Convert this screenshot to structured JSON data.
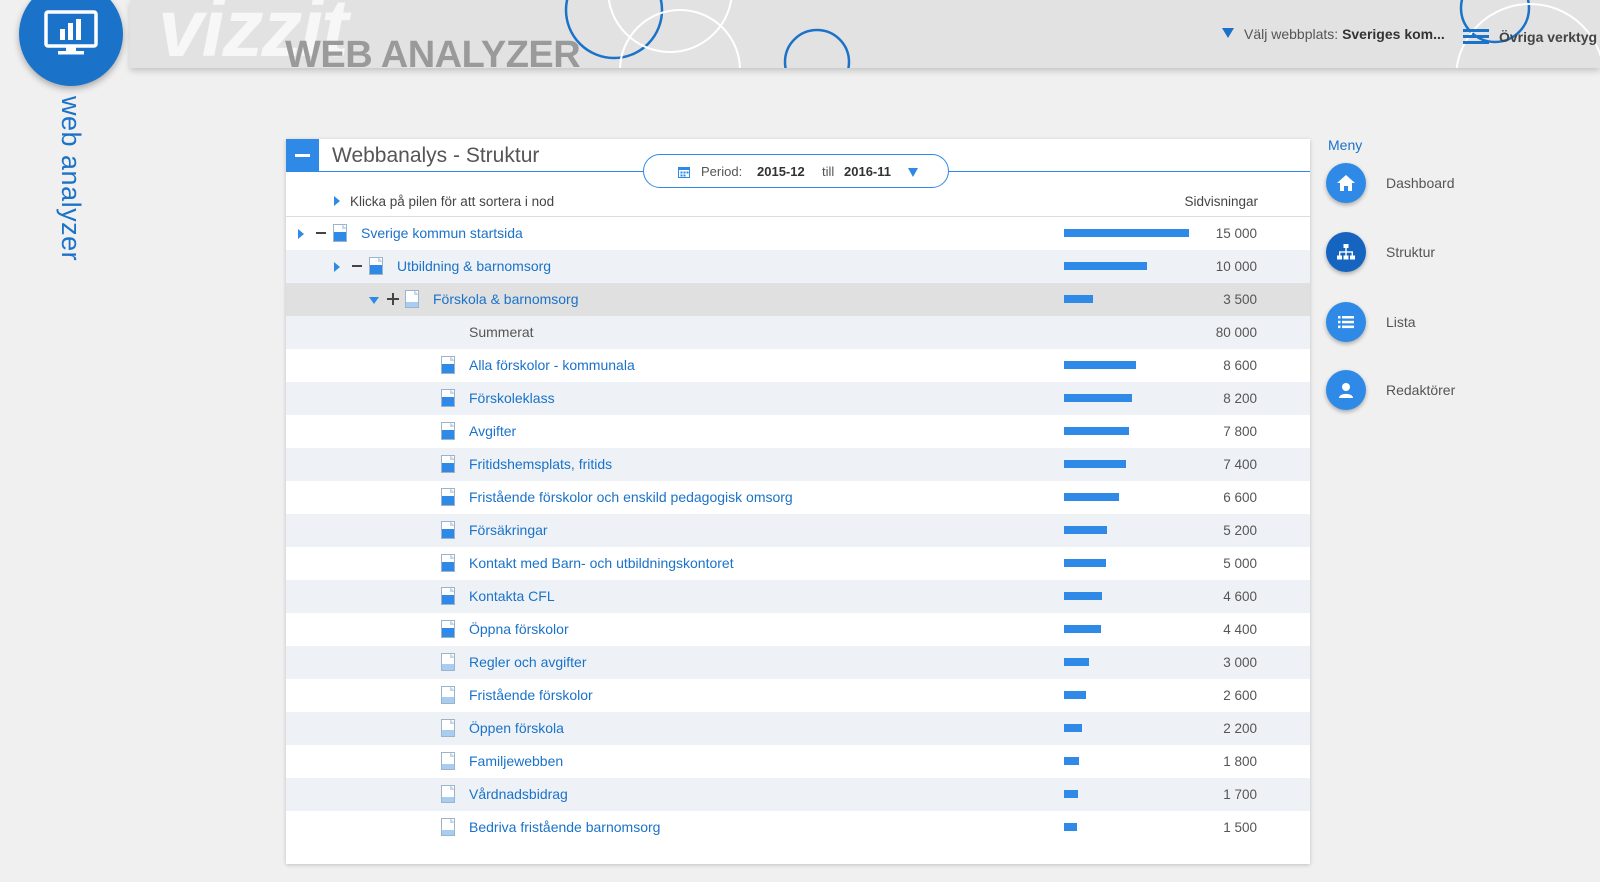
{
  "header": {
    "brand_bg": "vizzit",
    "brand_fg": "WEB ANALYZER",
    "site_select_prefix": "Välj webbplats:",
    "site_select_value": "Sveriges kom...",
    "tools_label": "Övriga verktyg"
  },
  "app": {
    "vertical_title": "web analyzer"
  },
  "panel": {
    "title": "Webbanalys - Struktur",
    "period_label": "Period:",
    "period_from": "2015-12",
    "period_till": "till",
    "period_to": "2016-11",
    "hint": "Klicka på pilen för att sortera i nod",
    "column_header": "Sidvisningar",
    "bar_max": 15000,
    "rows": [
      {
        "label": "Sverige kommun startsida",
        "value": "15 000",
        "num": 15000,
        "level": 0,
        "controls": "arrow-minus",
        "doc": 0.55
      },
      {
        "label": "Utbildning & barnomsorg",
        "value": "10 000",
        "num": 10000,
        "level": 1,
        "controls": "arrow-minus",
        "doc": 0.55
      },
      {
        "label": "Förskola & barnomsorg",
        "value": "3 500",
        "num": 3500,
        "level": 2,
        "controls": "down-plus",
        "doc": 0.3,
        "selected": true
      },
      {
        "label": "Summerat",
        "value": "80 000",
        "num": null,
        "level": 3,
        "controls": "none",
        "static": true
      },
      {
        "label": "Alla förskolor - kommunala",
        "value": "8 600",
        "num": 8600,
        "level": 3,
        "controls": "none",
        "doc": 0.55
      },
      {
        "label": "Förskoleklass",
        "value": "8 200",
        "num": 8200,
        "level": 3,
        "controls": "none",
        "doc": 0.55
      },
      {
        "label": "Avgifter",
        "value": "7 800",
        "num": 7800,
        "level": 3,
        "controls": "none",
        "doc": 0.55
      },
      {
        "label": "Fritidshemsplats, fritids",
        "value": "7 400",
        "num": 7400,
        "level": 3,
        "controls": "none",
        "doc": 0.55
      },
      {
        "label": "Fristående förskolor och enskild pedagogisk omsorg",
        "value": "6 600",
        "num": 6600,
        "level": 3,
        "controls": "none",
        "doc": 0.55
      },
      {
        "label": "Försäkringar",
        "value": "5 200",
        "num": 5200,
        "level": 3,
        "controls": "none",
        "doc": 0.55
      },
      {
        "label": "Kontakt med Barn- och utbildningskontoret",
        "value": "5 000",
        "num": 5000,
        "level": 3,
        "controls": "none",
        "doc": 0.55
      },
      {
        "label": "Kontakta CFL",
        "value": "4 600",
        "num": 4600,
        "level": 3,
        "controls": "none",
        "doc": 0.55
      },
      {
        "label": "Öppna förskolor",
        "value": "4 400",
        "num": 4400,
        "level": 3,
        "controls": "none",
        "doc": 0.55
      },
      {
        "label": "Regler och avgifter",
        "value": "3 000",
        "num": 3000,
        "level": 3,
        "controls": "none",
        "doc": 0.4
      },
      {
        "label": "Fristående förskolor",
        "value": "2 600",
        "num": 2600,
        "level": 3,
        "controls": "none",
        "doc": 0.4
      },
      {
        "label": "Öppen förskola",
        "value": "2 200",
        "num": 2200,
        "level": 3,
        "controls": "none",
        "doc": 0.4
      },
      {
        "label": "Familjewebben",
        "value": "1 800",
        "num": 1800,
        "level": 3,
        "controls": "none",
        "doc": 0.3
      },
      {
        "label": "Vårdnadsbidrag",
        "value": "1 700",
        "num": 1700,
        "level": 3,
        "controls": "none",
        "doc": 0.3
      },
      {
        "label": "Bedriva fristående barnomsorg",
        "value": "1 500",
        "num": 1500,
        "level": 3,
        "controls": "none",
        "doc": 0.3
      }
    ]
  },
  "menu": {
    "title": "Meny",
    "items": [
      {
        "label": "Dashboard",
        "icon": "home-icon"
      },
      {
        "label": "Struktur",
        "icon": "sitemap-icon",
        "active": true
      },
      {
        "label": "Lista",
        "icon": "list-icon"
      },
      {
        "label": "Redaktörer",
        "icon": "user-icon"
      }
    ]
  },
  "colors": {
    "accent": "#2e8ae6",
    "accent_dark": "#1a72c9",
    "doc_fill_dark": "#2e8ae6",
    "doc_fill_light": "#a9cdf0"
  }
}
